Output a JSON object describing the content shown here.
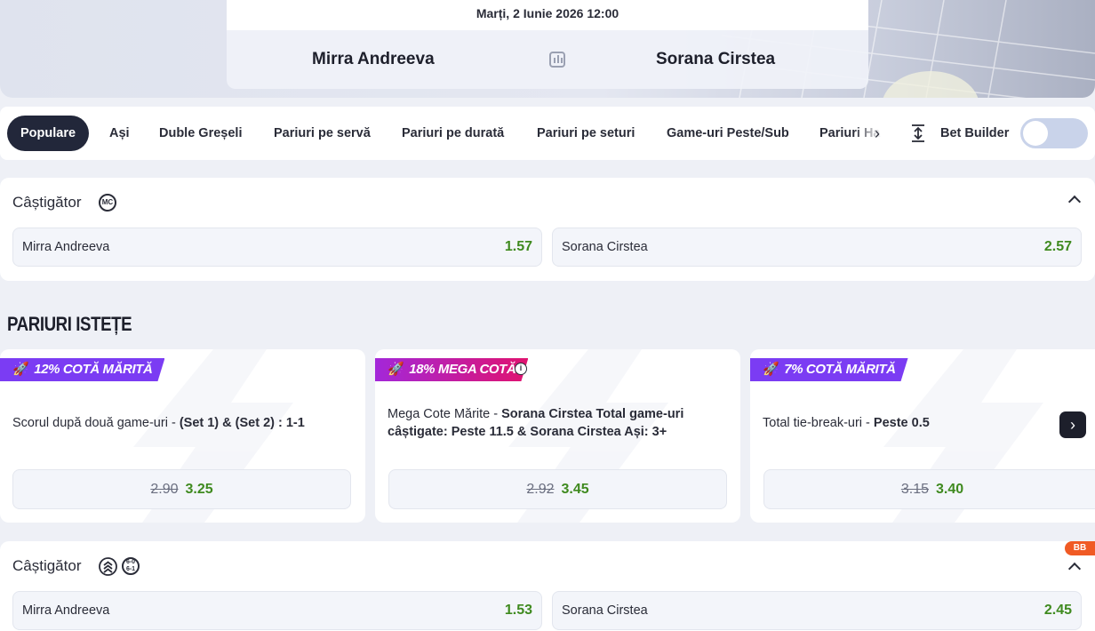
{
  "match": {
    "date": "Marți, 2 Iunie 2026 12:00",
    "home": "Mirra Andreeva",
    "away": "Sorana Cirstea"
  },
  "tabs": [
    {
      "label": "Populare",
      "active": true
    },
    {
      "label": "Ași"
    },
    {
      "label": "Duble Greșeli"
    },
    {
      "label": "Pariuri pe servă"
    },
    {
      "label": "Pariuri pe durată"
    },
    {
      "label": "Pariuri pe seturi"
    },
    {
      "label": "Game-uri Peste/Sub"
    },
    {
      "label": "Pariuri Ha"
    }
  ],
  "bet_builder": {
    "label": "Bet Builder",
    "enabled": false
  },
  "market1": {
    "title": "Câștigător",
    "badge": "MC",
    "selections": [
      {
        "name": "Mirra Andreeva",
        "price": "1.57"
      },
      {
        "name": "Sorana Cirstea",
        "price": "2.57"
      }
    ]
  },
  "smart_section_title": "PARIURI ISTEȚE",
  "smart_bets": [
    {
      "badge": "12% COTĂ MĂRITĂ",
      "badge_color": "#7b3cf3",
      "desc_plain": "Scorul după două game-uri - ",
      "desc_bold": "(Set 1) & (Set 2) : 1-1",
      "old": "2.90",
      "new": "3.25"
    },
    {
      "badge": "18% MEGA COTĂ",
      "badge_color": "#c0209f",
      "desc_plain": "Mega Cote Mărite - ",
      "desc_bold": "Sorana Cirstea Total game-uri câștigate: Peste 11.5 & Sorana Cirstea Ași: 3+",
      "old": "2.92",
      "new": "3.45"
    },
    {
      "badge": "7% COTĂ MĂRITĂ",
      "badge_color": "#7b3cf3",
      "desc_plain": "Total tie-break-uri - ",
      "desc_bold": "Peste 0.5",
      "old": "3.15",
      "new": "3.40"
    }
  ],
  "market2": {
    "title": "Câștigător",
    "bb_tag": "BB",
    "sets_icon": "6-0 6-1",
    "selections": [
      {
        "name": "Mirra Andreeva",
        "price": "1.53"
      },
      {
        "name": "Sorana Cirstea",
        "price": "2.45"
      }
    ]
  },
  "colors": {
    "odds_green": "#3f8a1f",
    "active_tab": "#22273a",
    "bb_orange": "#f05a24"
  }
}
